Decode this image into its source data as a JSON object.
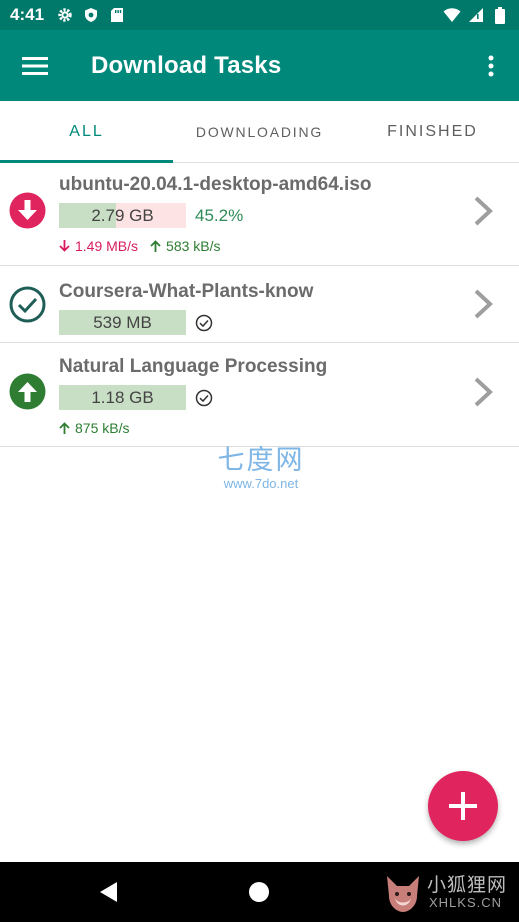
{
  "status_bar": {
    "time": "4:41",
    "left_icons": [
      "gear-icon",
      "shield-icon",
      "sd-card-icon"
    ],
    "right_icons": [
      "wifi-icon",
      "signal-icon",
      "battery-icon"
    ]
  },
  "app_bar": {
    "title": "Download Tasks",
    "menu_icon": "hamburger-menu-icon",
    "more_icon": "more-vert-icon",
    "color": "#00897b"
  },
  "tabs": [
    {
      "label": "ALL",
      "selected": true
    },
    {
      "label": "DOWNLOADING",
      "selected": false
    },
    {
      "label": "FINISHED",
      "selected": false
    }
  ],
  "tasks": [
    {
      "title": "ubuntu-20.04.1-desktop-amd64.iso",
      "status_icon": "download-arrow-icon",
      "status_color": "#e0245e",
      "size": "2.79 GB",
      "progress_percent": 45.2,
      "progress_label": "45.2%",
      "download_speed": "1.49 MB/s",
      "upload_speed": "583 kB/s"
    },
    {
      "title": "Coursera-What-Plants-know",
      "status_icon": "check-circle-icon",
      "status_color": "#00695c",
      "size": "539 MB",
      "progress_percent": 100
    },
    {
      "title": "Natural Language Processing",
      "status_icon": "upload-arrow-icon",
      "status_color": "#2e7d32",
      "size": "1.18 GB",
      "progress_percent": 100,
      "upload_speed": "875 kB/s"
    }
  ],
  "watermark": {
    "big": "七度网",
    "small": "www.7do.net"
  },
  "fab": {
    "icon": "plus-icon",
    "color": "#e0245e"
  },
  "nav_bar": {
    "back_icon": "nav-back-icon",
    "home_icon": "nav-home-icon",
    "watermark_text": "小狐狸网",
    "watermark_sub": "XHLKS.CN"
  }
}
